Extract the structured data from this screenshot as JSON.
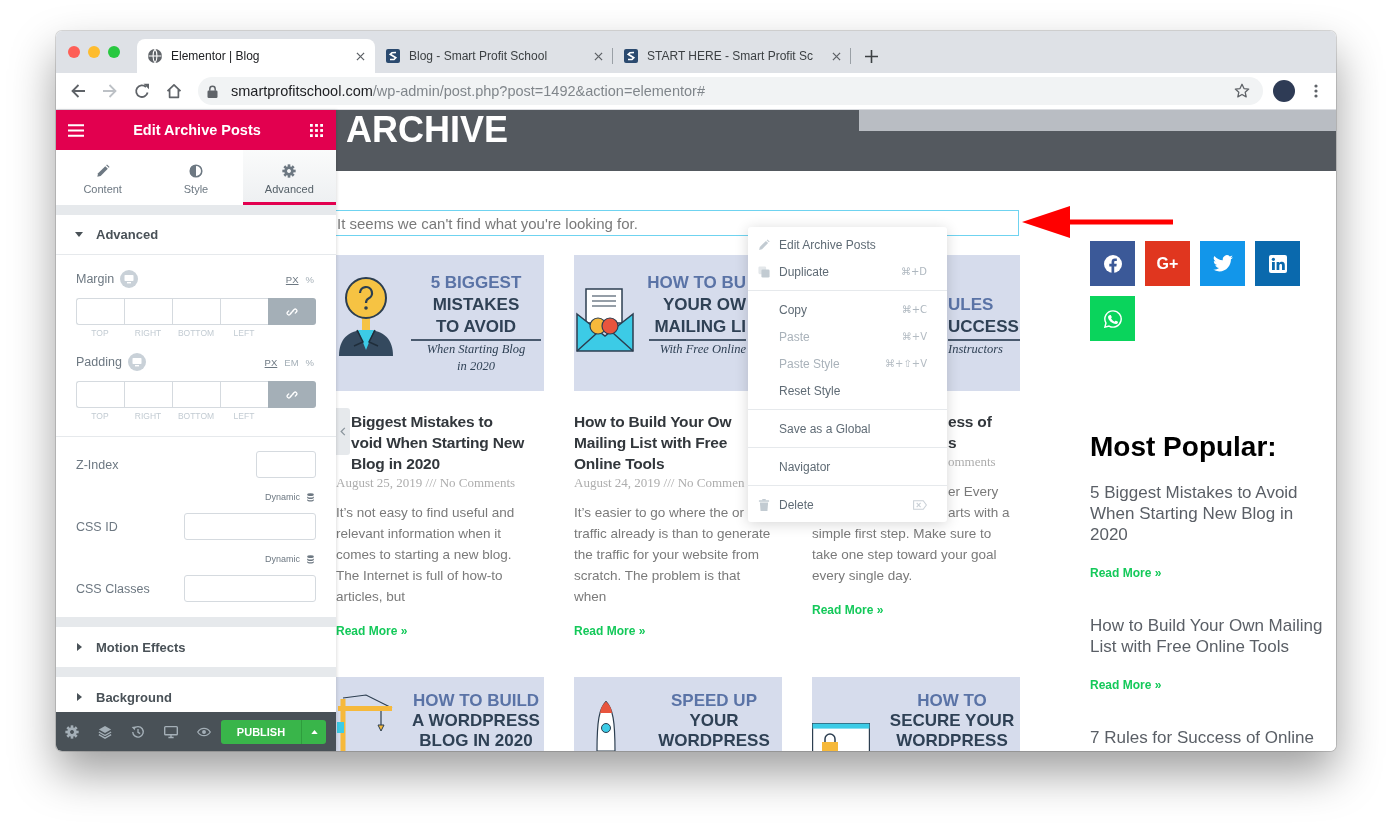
{
  "browser": {
    "tabs": [
      {
        "kind": "globe",
        "title": "Elementor | Blog",
        "selected": true
      },
      {
        "kind": "site",
        "title": "Blog - Smart Profit School",
        "selected": false
      },
      {
        "kind": "site",
        "title": "START HERE - Smart Profit Sc",
        "selected": false
      }
    ],
    "address": {
      "domain": "smartprofitschool.com",
      "path": "/wp-admin/post.php?post=1492&action=elementor#"
    }
  },
  "panel": {
    "title": "Edit Archive Posts",
    "tabs": [
      {
        "kind": "pencil",
        "label": "Content",
        "selected": false
      },
      {
        "kind": "contrast",
        "label": "Style",
        "selected": false
      },
      {
        "kind": "gear",
        "label": "Advanced",
        "selected": true
      }
    ],
    "sections": [
      {
        "title": "Advanced",
        "expanded": true,
        "controls": [
          {
            "kind": "dimensions",
            "label": "Margin",
            "units": [
              {
                "label": "PX",
                "selected": true
              },
              {
                "label": "%",
                "selected": false
              }
            ],
            "sides": [
              "TOP",
              "RIGHT",
              "BOTTOM",
              "LEFT"
            ]
          },
          {
            "kind": "dimensions",
            "label": "Padding",
            "units": [
              {
                "label": "PX",
                "selected": true
              },
              {
                "label": "EM",
                "selected": false
              },
              {
                "label": "%",
                "selected": false
              }
            ],
            "sides": [
              "TOP",
              "RIGHT",
              "BOTTOM",
              "LEFT"
            ]
          },
          {
            "kind": "number",
            "label": "Z-Index"
          },
          {
            "kind": "text",
            "label": "CSS ID",
            "dynamic": "Dynamic"
          },
          {
            "kind": "text",
            "label": "CSS Classes",
            "dynamic": "Dynamic"
          }
        ]
      },
      {
        "title": "Motion Effects",
        "expanded": false
      },
      {
        "title": "Background",
        "expanded": false
      }
    ],
    "publish": "PUBLISH"
  },
  "canvas": {
    "header_title": "ARCHIVE",
    "notice": "It seems we can't find what you're looking for.",
    "posts": [
      {
        "thumbnail": {
          "kind": "person",
          "lines": [
            {
              "text": "5 BIGGEST",
              "accent": true
            },
            {
              "text": "MISTAKES",
              "accent": false
            },
            {
              "text": "TO AVOID",
              "accent": false
            }
          ],
          "tagline": "When Starting Blog\nin 2020"
        },
        "title": "Biggest Mistakes to\nvoid When Starting New\nBlog in 2020",
        "meta": "August 25, 2019 /// No Comments",
        "excerpt": [
          "It’s not easy to find useful and\nrelevant information when it\ncomes to starting a new blog.\nThe Internet is full of how-to\narticles, but"
        ],
        "read_more": "Read More »"
      },
      {
        "thumbnail": {
          "kind": "envelope",
          "lines": [
            {
              "text": "HOW TO BU",
              "accent": true
            },
            {
              "text": "YOUR OW",
              "accent": false
            },
            {
              "text": "MAILING LI",
              "accent": false
            }
          ],
          "tagline": "With Free Online"
        },
        "title": "How to Build Your Ow\nMailing List with Free\nOnline Tools",
        "meta": "August 24, 2019 /// No Commen",
        "excerpt": [
          "It’s easier to go where the or",
          "traffic already is than to generate\nthe traffic for your website from\nscratch. The problem is that\nwhen"
        ],
        "read_more": "Read More »"
      },
      {
        "thumbnail": {
          "lines": [
            {
              "text": "ULES",
              "accent": true
            },
            {
              "text": "UCCESS",
              "accent": false
            }
          ],
          "tagline": "Instructors"
        },
        "title": "ess of\ns",
        "meta": "omments",
        "excerpt": [
          "er Every\narts with a",
          "simple first step. Make sure to\ntake one step toward your goal\nevery single day."
        ],
        "read_more": "Read More »"
      },
      {
        "thumbnail": {
          "kind": "crane",
          "lines": [
            {
              "text": "HOW TO BUILD",
              "accent": true
            },
            {
              "text": "A WORDPRESS",
              "accent": false
            },
            {
              "text": "BLOG IN 2020",
              "accent": false
            }
          ]
        }
      },
      {
        "thumbnail": {
          "kind": "rocket",
          "lines": [
            {
              "text": "SPEED UP",
              "accent": true
            },
            {
              "text": "YOUR",
              "accent": false
            },
            {
              "text": "WORDPRESS",
              "accent": false
            }
          ]
        }
      },
      {
        "thumbnail": {
          "kind": "browser",
          "lines": [
            {
              "text": "HOW TO",
              "accent": true
            },
            {
              "text": "SECURE YOUR",
              "accent": false
            },
            {
              "text": "WORDPRESS",
              "accent": false
            }
          ]
        }
      }
    ],
    "context_menu": {
      "groups": [
        {
          "items": [
            {
              "kind": "edit",
              "label": "Edit Archive Posts",
              "disabled": false
            },
            {
              "kind": "duplicate",
              "label": "Duplicate",
              "shortcut": "⌘+D",
              "disabled": false
            }
          ]
        },
        {
          "items": [
            {
              "kind": "plain",
              "label": "Copy",
              "shortcut": "⌘+C",
              "disabled": false
            },
            {
              "kind": "plain",
              "label": "Paste",
              "shortcut": "⌘+V",
              "disabled": true
            },
            {
              "kind": "plain",
              "label": "Paste Style",
              "shortcut": "⌘+⇧+V",
              "disabled": true
            },
            {
              "kind": "plain",
              "label": "Reset Style",
              "disabled": false
            }
          ]
        },
        {
          "items": [
            {
              "kind": "plain",
              "label": "Save as a Global",
              "disabled": false
            }
          ]
        },
        {
          "items": [
            {
              "kind": "plain",
              "label": "Navigator",
              "disabled": false
            }
          ]
        },
        {
          "items": [
            {
              "kind": "delete",
              "label": "Delete",
              "disabled": false
            }
          ]
        }
      ]
    },
    "sidebar": {
      "social": [
        {
          "kind": "facebook",
          "color": "#3b5998"
        },
        {
          "kind": "googleplus",
          "label": "G+",
          "color": "#e0361f"
        },
        {
          "kind": "twitter",
          "color": "#1296ea"
        },
        {
          "kind": "linkedin",
          "color": "#0a69ad"
        },
        {
          "kind": "whatsapp",
          "color": "#0ad45c"
        }
      ],
      "heading": "Most Popular:",
      "items": [
        {
          "title": "5 Biggest Mistakes to Avoid\nWhen Starting New Blog in\n2020",
          "read_more": "Read More »"
        },
        {
          "title": "How to Build Your Own Mailing\nList with Free Online Tools",
          "read_more": "Read More »"
        },
        {
          "title": "7 Rules for Success of Online"
        }
      ]
    }
  }
}
